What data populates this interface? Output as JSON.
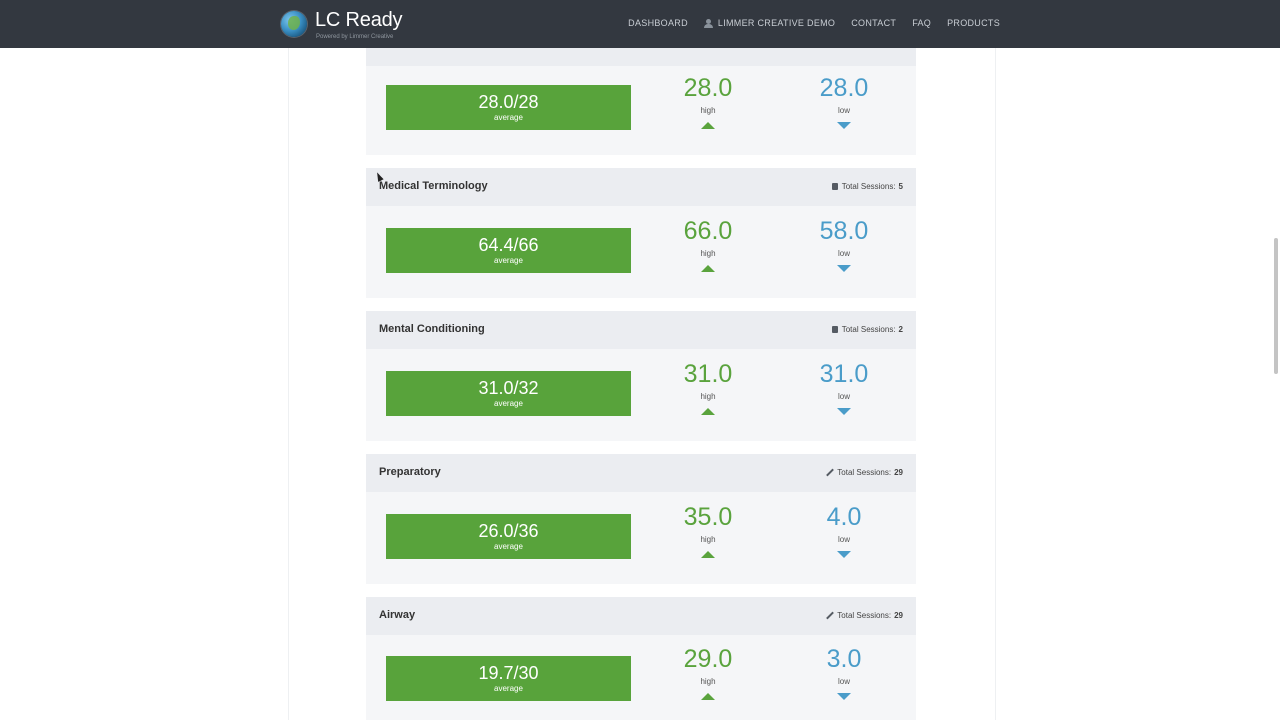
{
  "header": {
    "brand_name": "LC Ready",
    "brand_tagline": "Powered by Limmer Creative",
    "nav": {
      "dashboard": "DASHBOARD",
      "user": "LIMMER CREATIVE DEMO",
      "contact": "CONTACT",
      "faq": "FAQ",
      "products": "PRODUCTS"
    }
  },
  "colors": {
    "navbar": "#333840",
    "average_bar": "#58a33b",
    "high": "#5aa33d",
    "low": "#4a9cc9",
    "card_header": "#ebedf1"
  },
  "cards": [
    {
      "title": "",
      "sessions_label": "",
      "sessions_count": "",
      "average": "28.0/28",
      "average_label": "average",
      "high": "28.0",
      "high_label": "high",
      "low": "28.0",
      "low_label": "low"
    },
    {
      "title": "Medical Terminology",
      "icon": "book-icon",
      "sessions_label": "Total Sessions:",
      "sessions_count": "5",
      "average": "64.4/66",
      "average_label": "average",
      "high": "66.0",
      "high_label": "high",
      "low": "58.0",
      "low_label": "low"
    },
    {
      "title": "Mental Conditioning",
      "icon": "book-icon",
      "sessions_label": "Total Sessions:",
      "sessions_count": "2",
      "average": "31.0/32",
      "average_label": "average",
      "high": "31.0",
      "high_label": "high",
      "low": "31.0",
      "low_label": "low"
    },
    {
      "title": "Preparatory",
      "icon": "pencil-icon",
      "sessions_label": "Total Sessions:",
      "sessions_count": "29",
      "average": "26.0/36",
      "average_label": "average",
      "high": "35.0",
      "high_label": "high",
      "low": "4.0",
      "low_label": "low"
    },
    {
      "title": "Airway",
      "icon": "pencil-icon",
      "sessions_label": "Total Sessions:",
      "sessions_count": "29",
      "average": "19.7/30",
      "average_label": "average",
      "high": "29.0",
      "high_label": "high",
      "low": "3.0",
      "low_label": "low"
    }
  ]
}
